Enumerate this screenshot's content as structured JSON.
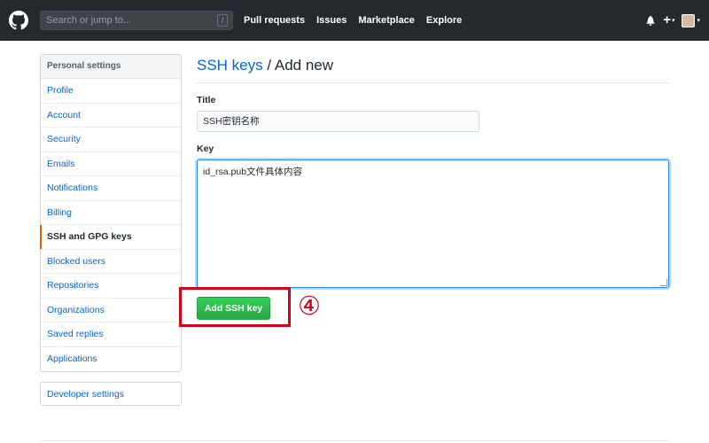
{
  "header": {
    "search_placeholder": "Search or jump to...",
    "search_shortcut": "/",
    "nav": [
      "Pull requests",
      "Issues",
      "Marketplace",
      "Explore"
    ],
    "plus_label": "+",
    "caret": "▾"
  },
  "sidebar": {
    "heading": "Personal settings",
    "items": [
      {
        "label": "Profile"
      },
      {
        "label": "Account"
      },
      {
        "label": "Security"
      },
      {
        "label": "Emails"
      },
      {
        "label": "Notifications"
      },
      {
        "label": "Billing"
      },
      {
        "label": "SSH and GPG keys",
        "selected": true
      },
      {
        "label": "Blocked users"
      },
      {
        "label": "Repositories"
      },
      {
        "label": "Organizations"
      },
      {
        "label": "Saved replies"
      },
      {
        "label": "Applications"
      }
    ],
    "developer_settings": "Developer settings"
  },
  "main": {
    "breadcrumb_link": "SSH keys",
    "breadcrumb_rest": " / Add new",
    "title_label": "Title",
    "title_value": "SSH密钥名称",
    "key_label": "Key",
    "key_value": "id_rsa.pub文件具体内容",
    "add_button": "Add SSH key"
  },
  "annotation": {
    "step_marker": "④",
    "color": "#d0021b"
  },
  "colors": {
    "header_bg": "#24292e",
    "link": "#0366d6",
    "selected_indicator": "#e36209",
    "button_green": "#28a745"
  }
}
